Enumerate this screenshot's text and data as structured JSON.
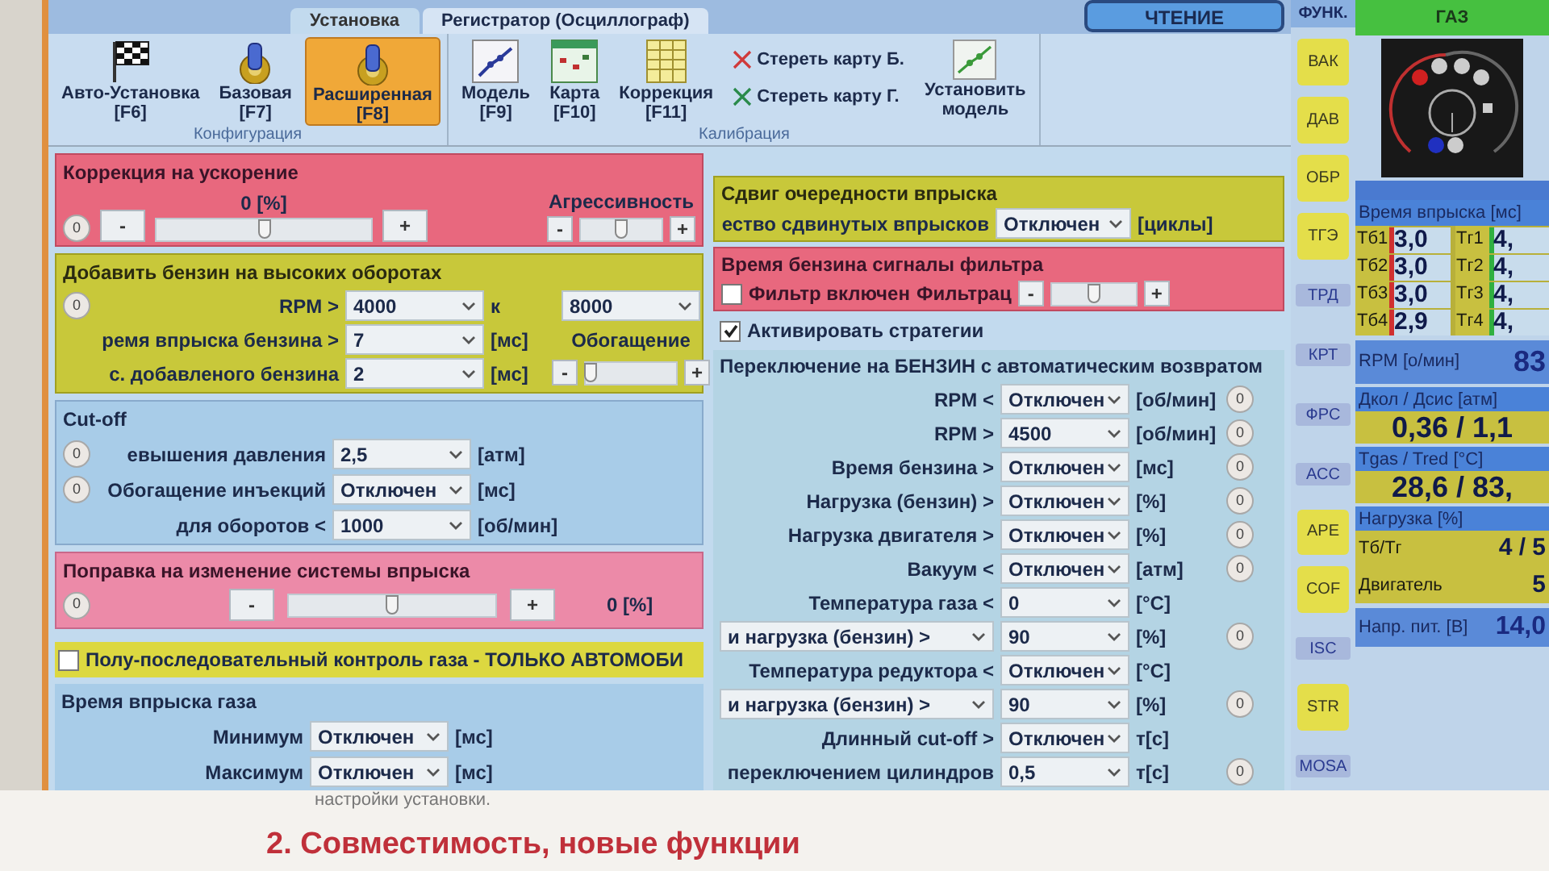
{
  "tabs": [
    {
      "label": "Установка",
      "selected": true
    },
    {
      "label": "Регистратор (Осциллограф)",
      "selected": false
    }
  ],
  "read_button": "ЧТЕНИЕ",
  "ribbon": [
    {
      "label": "Конфигурация",
      "buttons": [
        {
          "kind": "flag",
          "label": "Авто-Установка",
          "key": "[F6]",
          "selected": false
        },
        {
          "kind": "gear",
          "label": "Базовая",
          "key": "[F7]",
          "selected": false
        },
        {
          "kind": "gear",
          "label": "Расширенная",
          "key": "[F8]",
          "selected": true
        }
      ]
    },
    {
      "label": "Калибрация",
      "buttons": [
        {
          "kind": "line",
          "label": "Модель",
          "key": "[F9]",
          "selected": false
        },
        {
          "kind": "map",
          "label": "Карта",
          "key": "[F10]",
          "selected": false
        },
        {
          "kind": "table",
          "label": "Коррекция",
          "key": "[F11]",
          "selected": false
        }
      ],
      "actions": [
        {
          "label": "Стереть карту Б.",
          "color": "#d03a3a"
        },
        {
          "label": "Стереть карту Г.",
          "color": "#2a8a4a"
        }
      ],
      "model_button": "Установить модель"
    }
  ],
  "acceleration": {
    "title": "Коррекция на ускорение",
    "reading": "0 [%]",
    "reset": "0",
    "minus": "-",
    "plus": "+",
    "slider": {
      "level": 0.5
    },
    "aggressiveness": {
      "label": "Агрессивность",
      "minus": "-",
      "plus": "+",
      "slider": {
        "level": 0.5
      }
    }
  },
  "high_rpm": {
    "title": "Добавить бензин на высоких оборотах",
    "reset": "0",
    "rows": [
      {
        "label": "RPM >",
        "value": "4000",
        "unit": "к"
      },
      {
        "label": "ремя впрыска бензина >",
        "value": "7",
        "unit": "[мс]"
      },
      {
        "label": "с. добавленого бензина",
        "value": "2",
        "unit": "[мс]"
      }
    ],
    "rpm_to": "8000",
    "enrichment": {
      "label": "Обогащение",
      "minus": "-",
      "plus": "+",
      "slider": {
        "level": 0.05
      }
    }
  },
  "cutoff": {
    "title": "Cut-off",
    "rows": [
      {
        "label": "евышения давления",
        "value": "2,5",
        "unit": "[атм]",
        "reset": "0"
      },
      {
        "label": "Обогащение инъекций",
        "value": "Отключен",
        "unit": "[мс]",
        "reset": "0"
      },
      {
        "label": "для оборотов <",
        "value": "1000",
        "unit": "[об/мин]"
      }
    ]
  },
  "system_change": {
    "title": "Поправка на изменение системы впрыска",
    "reset": "0",
    "minus": "-",
    "plus": "+",
    "slider": {
      "level": 0.5
    },
    "reading": "0 [%]"
  },
  "semi_sequential": {
    "label": "Полу-последовательный контроль газа - ТОЛЬКО АВТОМОБИ",
    "checked": false
  },
  "gas_time": {
    "title": "Время впрыска газа",
    "rows": [
      {
        "label": "Минимум",
        "value": "Отключен",
        "unit": "[мс]"
      },
      {
        "label": "Максимум",
        "value": "Отключен",
        "unit": "[мс]"
      }
    ]
  },
  "shift": {
    "title": "Сдвиг очередности впрыска",
    "label": "ество сдвинутых впрысков",
    "value": "Отключен",
    "unit": "[циклы]"
  },
  "filter": {
    "title": "Время бензина сигналы фильтра",
    "checkbox": {
      "label": "Фильтр включен",
      "checked": false
    },
    "label": "Фильтрац",
    "minus": "-",
    "plus": "+",
    "slider": {
      "level": 0.5
    }
  },
  "strategies": {
    "label": "Активировать стратегии",
    "checked": true
  },
  "switching": {
    "title": "Переключение на БЕНЗИН с автоматическим возвратом",
    "rows": [
      {
        "kind": "text",
        "label": "RPM <",
        "value": "Отключен",
        "unit": "[об/мин]",
        "reset": "0"
      },
      {
        "kind": "text",
        "label": "RPM >",
        "value": "4500",
        "unit": "[об/мин]",
        "reset": "0"
      },
      {
        "kind": "text",
        "label": "Время бензина >",
        "value": "Отключен",
        "unit": "[мс]",
        "reset": "0"
      },
      {
        "kind": "text",
        "label": "Нагрузка (бензин) >",
        "value": "Отключен",
        "unit": "[%]",
        "reset": "0"
      },
      {
        "kind": "text",
        "label": "Нагрузка двигателя >",
        "value": "Отключен",
        "unit": "[%]",
        "reset": "0"
      },
      {
        "kind": "text",
        "label": "Вакуум <",
        "value": "Отключен",
        "unit": "[атм]",
        "reset": "0"
      },
      {
        "kind": "text",
        "label": "Температура газа <",
        "value": "0",
        "unit": "[°C]"
      },
      {
        "kind": "dropdown",
        "label": "и нагрузка (бензин) >",
        "value": "90",
        "unit": "[%]",
        "reset": "0"
      },
      {
        "kind": "text",
        "label": "Температура редуктора <",
        "value": "Отключен",
        "unit": "[°C]"
      },
      {
        "kind": "dropdown",
        "label": "и нагрузка (бензин) >",
        "value": "90",
        "unit": "[%]",
        "reset": "0"
      },
      {
        "kind": "text",
        "label": "Длинный cut-off >",
        "value": "Отключен",
        "unit": "т[с]"
      },
      {
        "kind": "text",
        "label": "переключением цилиндров",
        "value": "0,5",
        "unit": "т[с]",
        "reset": "0"
      }
    ]
  },
  "functions": {
    "title": "ФУНК.",
    "buttons": [
      {
        "label": "ВАК",
        "on": true
      },
      {
        "label": "ДАВ",
        "on": true
      },
      {
        "label": "ОБР",
        "on": true
      },
      {
        "label": "ТГЭ",
        "on": true
      },
      {
        "label": "ТРД",
        "on": false
      },
      {
        "label": "КРТ",
        "on": false
      },
      {
        "label": "ФРС",
        "on": false
      },
      {
        "label": "АСС",
        "on": false
      },
      {
        "label": "APE",
        "on": true
      },
      {
        "label": "COF",
        "on": true
      },
      {
        "label": "ISC",
        "on": false
      },
      {
        "label": "STR",
        "on": true
      },
      {
        "label": "MOSA",
        "on": false
      }
    ]
  },
  "gas_panel": {
    "title": "ГАЗ",
    "injection_title": "Время впрыска [мс]",
    "petrol": [
      {
        "label": "Тб1",
        "value": "3,0"
      },
      {
        "label": "Тб2",
        "value": "3,0"
      },
      {
        "label": "Тб3",
        "value": "3,0"
      },
      {
        "label": "Тб4",
        "value": "2,9"
      }
    ],
    "gas": [
      {
        "label": "Тг1",
        "value": "4,"
      },
      {
        "label": "Тг2",
        "value": "4,"
      },
      {
        "label": "Тг3",
        "value": "4,"
      },
      {
        "label": "Тг4",
        "value": "4,"
      }
    ],
    "rpm": {
      "label": "RPM [о/мин]",
      "value": "83"
    },
    "pressure": {
      "label": "Дкол / Дсис [атм]",
      "value": "0,36 / 1,1"
    },
    "temperature": {
      "label": "Tgas / Tred [°C]",
      "value": "28,6 / 83,"
    },
    "load": {
      "label": "Нагрузка [%]",
      "rows": [
        {
          "label": "Тб/Тг",
          "value": "4 / 5"
        },
        {
          "label": "Двигатель",
          "value": "5"
        }
      ]
    },
    "voltage": {
      "label": "Напр. пит. [В]",
      "value": "14,0"
    }
  },
  "page_below": {
    "caption": "настройки установки.",
    "heading": "2. Совместимость, новые функции"
  }
}
